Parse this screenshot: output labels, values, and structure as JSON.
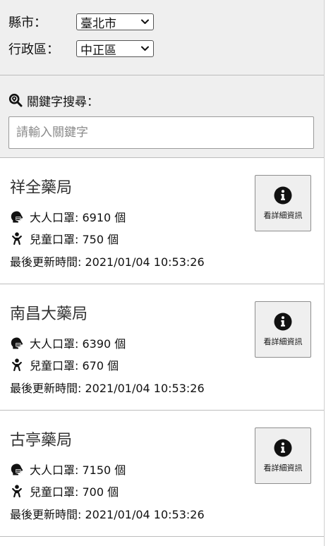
{
  "filters": {
    "city_label": "縣市：",
    "city_value": "臺北市",
    "district_label": "行政區：",
    "district_value": "中正區"
  },
  "search": {
    "label": "關鍵字搜尋：",
    "placeholder": "請輸入關鍵字",
    "value": ""
  },
  "stores": [
    {
      "name": "祥全藥局",
      "adult": "大人口罩: 6910 個",
      "child": "兒童口罩: 750 個",
      "updated": "最後更新時間: 2021/01/04 10:53:26",
      "detail_label": "看詳細資訊"
    },
    {
      "name": "南昌大藥局",
      "adult": "大人口罩: 6390 個",
      "child": "兒童口罩: 670 個",
      "updated": "最後更新時間: 2021/01/04 10:53:26",
      "detail_label": "看詳細資訊"
    },
    {
      "name": "古亭藥局",
      "adult": "大人口罩: 7150 個",
      "child": "兒童口罩: 700 個",
      "updated": "最後更新時間: 2021/01/04 10:53:26",
      "detail_label": "看詳細資訊"
    }
  ],
  "icons": {
    "search": "search-location-icon",
    "adult": "head-side-mask-icon",
    "child": "child-icon",
    "detail": "info-circle-icon",
    "dropdown": "chevron-down-icon"
  }
}
